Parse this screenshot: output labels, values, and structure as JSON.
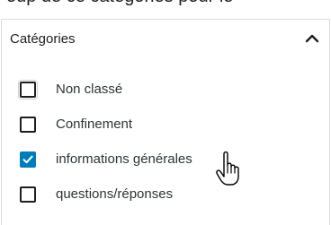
{
  "top_clipped_text": "oup de ce catégories pour le",
  "panel": {
    "title": "Catégories",
    "toggle_icon": "chevron-up-icon",
    "items": [
      {
        "label": "Non classé",
        "checked": false
      },
      {
        "label": "Confinement",
        "checked": false
      },
      {
        "label": "informations générales",
        "checked": true
      },
      {
        "label": "questions/réponses",
        "checked": false
      }
    ]
  },
  "colors": {
    "accent": "#007cba",
    "border": "#dcdcde",
    "text": "#1e1e1e"
  },
  "cursor_icon": "hand-pointer-icon"
}
